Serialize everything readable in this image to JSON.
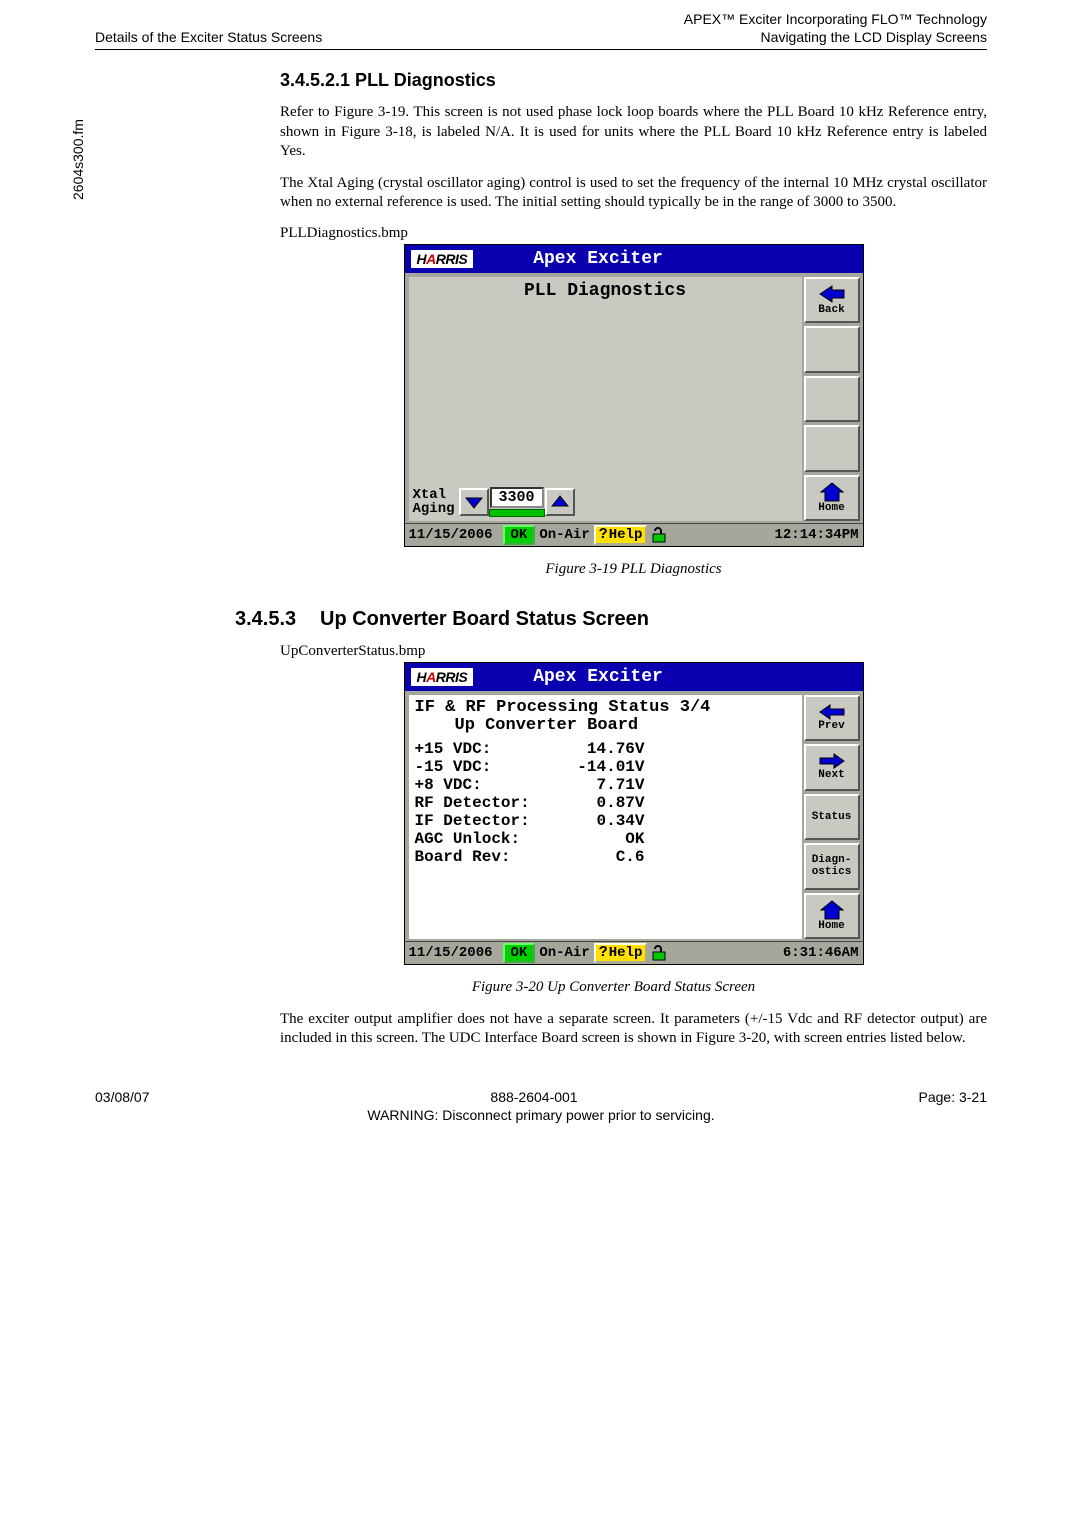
{
  "header": {
    "left": "Details of the Exciter Status Screens",
    "right1": "APEX™ Exciter Incorporating FLO™ Technology",
    "right2": "Navigating the LCD Display Screens"
  },
  "side_filename": "2604s300.fm",
  "section1": {
    "heading": "3.4.5.2.1  PLL Diagnostics",
    "para1": "Refer to Figure 3-19. This screen is not used phase lock loop boards where the PLL Board 10 kHz Reference entry, shown in Figure 3-18, is labeled N/A. It is used for units where the PLL Board 10 kHz Reference entry is labeled Yes.",
    "para2": "The Xtal Aging (crystal oscillator aging) control is used to set the frequency of the internal 10 MHz crystal oscillator when no external reference is used. The initial setting should typically be in the range of 3000 to 3500.",
    "bmp": "PLLDiagnostics.bmp",
    "caption": "Figure 3-19  PLL Diagnostics"
  },
  "section2": {
    "num": "3.4.5.3",
    "title": "Up Converter Board Status Screen",
    "bmp": "UpConverterStatus.bmp",
    "caption": "Figure 3-20  Up Converter Board Status Screen",
    "para": "The exciter output amplifier does not have a separate screen. It parameters (+/-15 Vdc and RF detector output) are included in this screen. The UDC Interface Board screen is shown in Figure 3-20, with screen entries listed below."
  },
  "lcd_common": {
    "logo_h": "H",
    "logo_a": "A",
    "logo_rest": "RRIS",
    "app_title": "Apex Exciter",
    "back": "Back",
    "home": "Home",
    "prev": "Prev",
    "next": "Next",
    "status": "Status",
    "diag1": "Diagn-",
    "diag2": "ostics",
    "ok": "OK",
    "onair": "On-Air",
    "help": "Help"
  },
  "screen1": {
    "title": "PLL Diagnostics",
    "xtal_l1": "Xtal",
    "xtal_l2": "Aging",
    "xtal_value": "3300",
    "date": "11/15/2006",
    "time": "12:14:34PM"
  },
  "screen2": {
    "title1": "IF & RF Processing Status 3/4",
    "title2": "Up Converter Board",
    "rows": [
      {
        "k": "+15 VDC:",
        "v": "14.76V"
      },
      {
        "k": "-15 VDC:",
        "v": "-14.01V"
      },
      {
        "k": "+8 VDC:",
        "v": "7.71V"
      },
      {
        "k": "RF Detector:",
        "v": "0.87V"
      },
      {
        "k": "IF Detector:",
        "v": "0.34V"
      },
      {
        "k": "AGC Unlock:",
        "v": "OK"
      },
      {
        "k": "Board Rev:",
        "v": "C.6"
      }
    ],
    "date": "11/15/2006",
    "time": "6:31:46AM"
  },
  "footer": {
    "date": "03/08/07",
    "docnum": "888-2604-001",
    "page": "Page: 3-21",
    "warning": "WARNING: Disconnect primary power prior to servicing."
  }
}
